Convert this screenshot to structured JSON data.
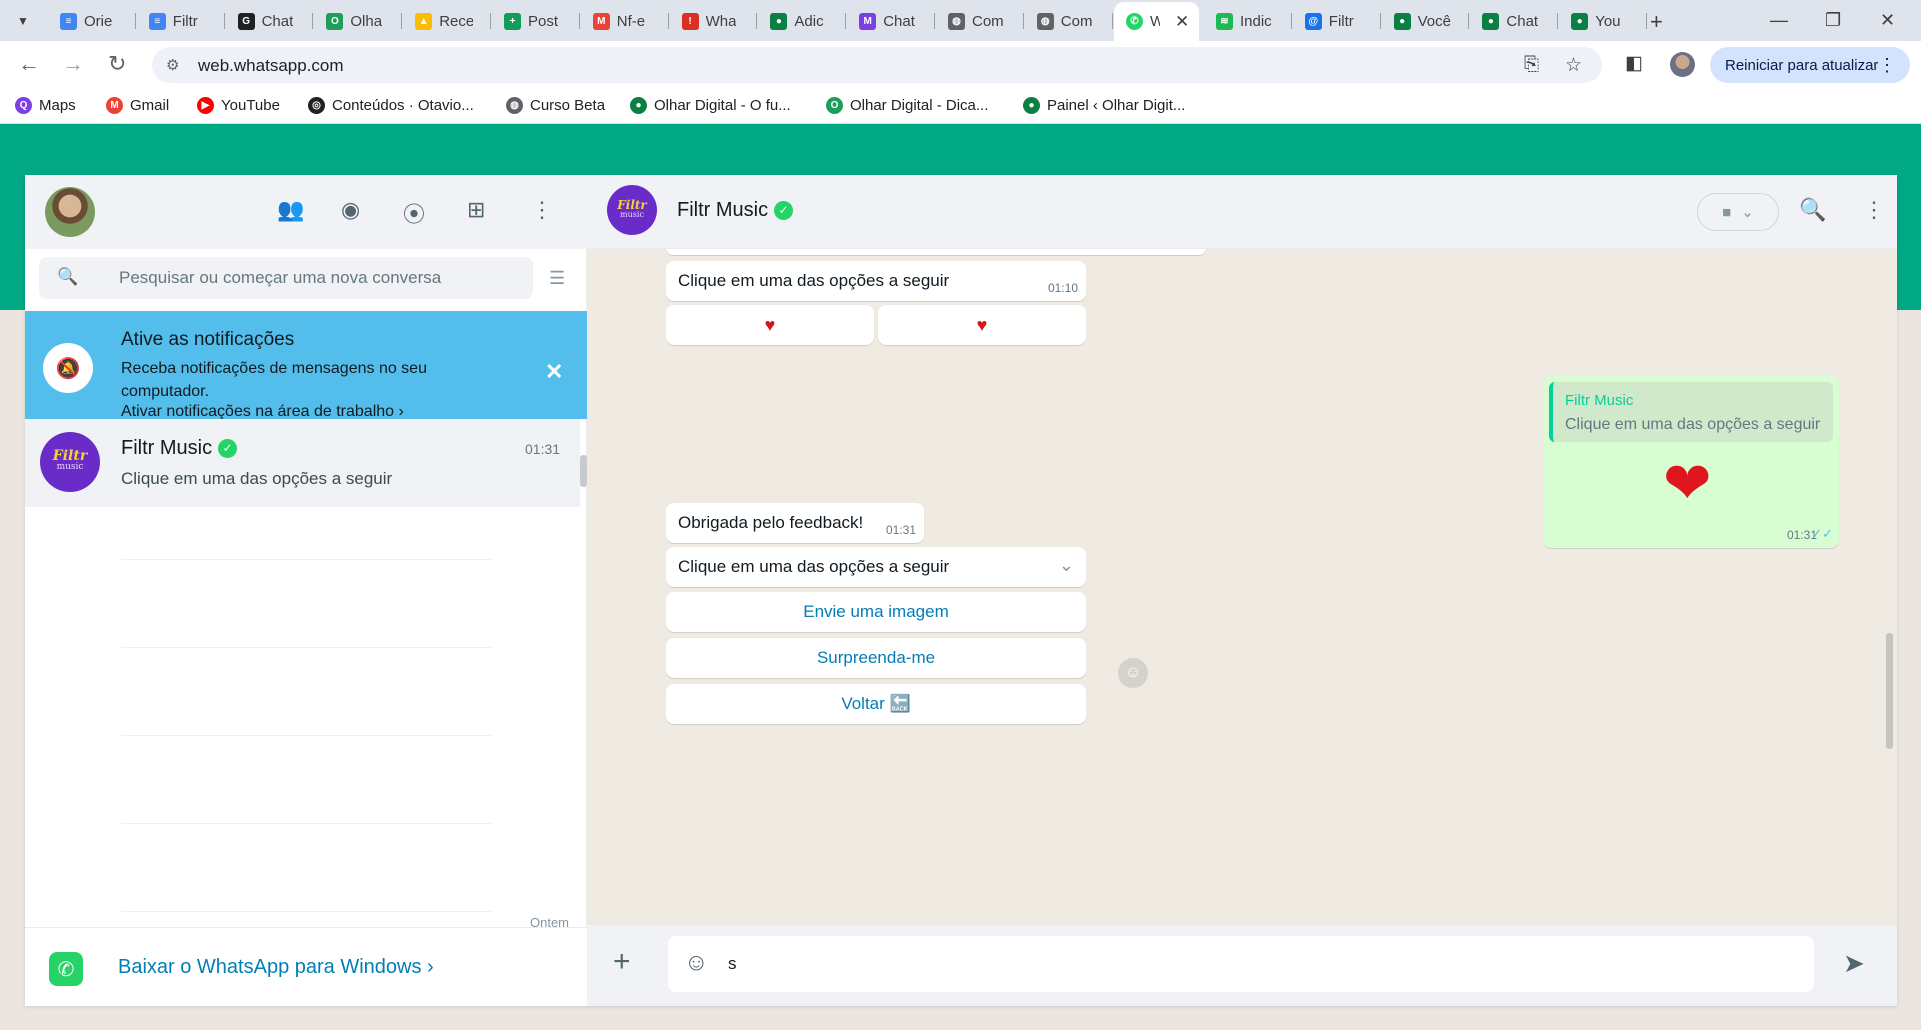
{
  "browser": {
    "tabs": [
      {
        "label": "Orie",
        "fav": "docs-icon",
        "color": "#4285f4",
        "glyph": "≡"
      },
      {
        "label": "Filtr",
        "fav": "docs-icon",
        "color": "#4285f4",
        "glyph": "≡"
      },
      {
        "label": "Chat",
        "fav": "chat-g-icon",
        "color": "#202124",
        "glyph": "G"
      },
      {
        "label": "Olha",
        "fav": "olhar-icon",
        "color": "#1e9e5b",
        "glyph": "O"
      },
      {
        "label": "Rece",
        "fav": "drive-icon",
        "color": "#fbbc04",
        "glyph": "▲"
      },
      {
        "label": "Post",
        "fav": "sheets-icon",
        "color": "#0f9d58",
        "glyph": "+"
      },
      {
        "label": "Nf-e",
        "fav": "gmail-icon",
        "color": "#ea4335",
        "glyph": "M"
      },
      {
        "label": "Wha",
        "fav": "alert-icon",
        "color": "#d93025",
        "glyph": "!"
      },
      {
        "label": "Adic",
        "fav": "green-dot-icon",
        "color": "#0b8043",
        "glyph": "●"
      },
      {
        "label": "Chat",
        "fav": "mg-icon",
        "color": "#7b3fe4",
        "glyph": "M"
      },
      {
        "label": "Com",
        "fav": "globe-icon",
        "color": "#5f6368",
        "glyph": "◍"
      },
      {
        "label": "Com",
        "fav": "globe-icon",
        "color": "#5f6368",
        "glyph": "◍"
      }
    ],
    "active_tab": {
      "label": "W",
      "fav": "whatsapp-tab-icon",
      "color": "#25d366"
    },
    "tabs_right": [
      {
        "label": "Indic",
        "fav": "spotify-icon",
        "color": "#1db954",
        "glyph": "≋"
      },
      {
        "label": "Filtr",
        "fav": "at-icon",
        "color": "#1a73e8",
        "glyph": "@"
      },
      {
        "label": "Você",
        "fav": "green-dot-icon",
        "color": "#0b8043",
        "glyph": "●"
      },
      {
        "label": "Chat",
        "fav": "green-dot-icon",
        "color": "#0b8043",
        "glyph": "●"
      },
      {
        "label": "You",
        "fav": "green-dot-icon",
        "color": "#0b8043",
        "glyph": "●"
      }
    ],
    "url": "web.whatsapp.com",
    "update_button": "Reiniciar para atualizar",
    "bookmarks": [
      {
        "label": "Maps",
        "color": "#7b3fe4",
        "glyph": "Q"
      },
      {
        "label": "Gmail",
        "color": "#ea4335",
        "glyph": "M"
      },
      {
        "label": "YouTube",
        "color": "#ff0000",
        "glyph": "▶"
      },
      {
        "label": "Conteúdos · Otavio...",
        "color": "#202124",
        "glyph": "◎"
      },
      {
        "label": "Curso Beta",
        "color": "#5f6368",
        "glyph": "◍"
      },
      {
        "label": "Olhar Digital - O fu...",
        "color": "#0b8043",
        "glyph": "●"
      },
      {
        "label": "Olhar Digital - Dica...",
        "color": "#1e9e5b",
        "glyph": "O"
      },
      {
        "label": "Painel ‹ Olhar Digit...",
        "color": "#0b8043",
        "glyph": "●"
      }
    ]
  },
  "whatsapp": {
    "colors": {
      "brand": "#00a884",
      "incoming": "#ffffff",
      "outgoing": "#d9fdd3",
      "link": "#027eb5",
      "notif": "#53bdeb"
    },
    "search": {
      "placeholder": "Pesquisar ou começar uma nova conversa",
      "value": ""
    },
    "notification": {
      "title": "Ative as notificações",
      "text": "Receba notificações de mensagens no seu computador.",
      "link": "Ativar notificações na área de trabalho ›"
    },
    "chat_list": [
      {
        "name": "Filtr Music",
        "time": "01:31",
        "preview": "Clique em uma das opções a seguir",
        "avatar_top": "Filtr",
        "avatar_bottom": "music"
      }
    ],
    "ghost_time": "Ontem",
    "download": {
      "text": "Baixar o WhatsApp para Windows ›"
    },
    "conversation": {
      "name": "Filtr Music",
      "avatar_top": "Filtr",
      "avatar_bottom": "music",
      "messages": {
        "m1_text": "Clique em uma das opções a seguir",
        "m1_time": "01:10",
        "heart_buttons": [
          "♥",
          "♥"
        ],
        "out_quote_name": "Filtr Music",
        "out_quote_text": "Clique em uma das opções a seguir",
        "out_time": "01:31",
        "m2_text": "Obrigada pelo feedback!",
        "m2_time": "01:31",
        "m3_text": "Clique em uma das opções a seguir",
        "buttons": [
          "Envie uma imagem",
          "Surpreenda-me",
          "Voltar 🔙"
        ]
      },
      "compose_value": "s"
    }
  }
}
